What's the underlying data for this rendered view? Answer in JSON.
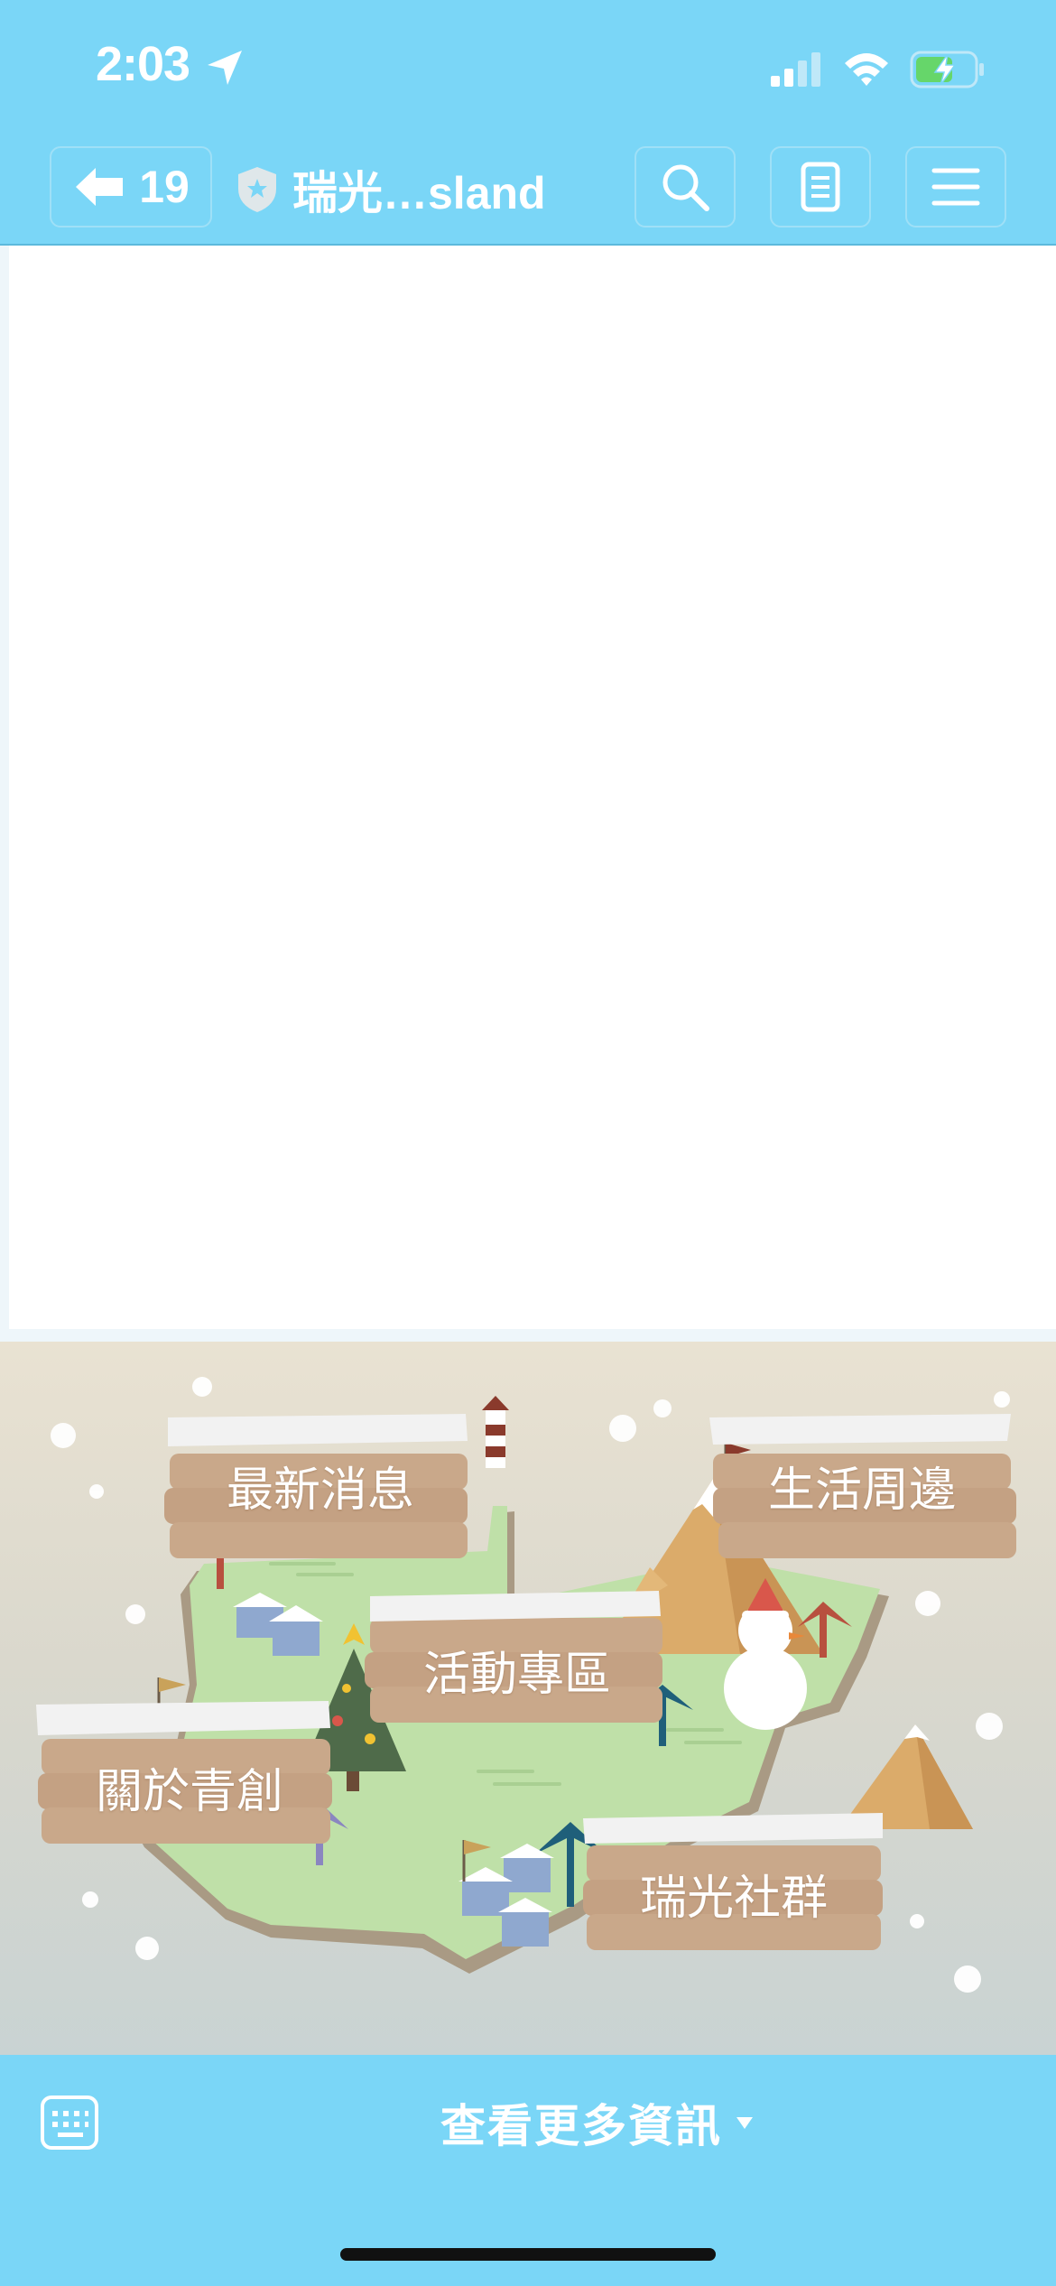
{
  "status_bar": {
    "time": "2:03",
    "icons": [
      "location-arrow-icon",
      "cellular-signal-icon",
      "wifi-icon",
      "battery-charging-icon"
    ]
  },
  "header": {
    "back_count": "19",
    "site_title": "瑞光…sland",
    "buttons": [
      "back-icon",
      "search-icon",
      "reader-icon",
      "menu-icon"
    ]
  },
  "map": {
    "signs": {
      "news": "最新消息",
      "life": "生活周邊",
      "event": "活動專區",
      "about": "關於青創",
      "community": "瑞光社群"
    }
  },
  "bottom_bar": {
    "more_info_label": "查看更多資訊"
  },
  "colors": {
    "accent": "#7ad6f7",
    "sign_wood": "#c9a88a",
    "land": "#bfe0a8"
  }
}
